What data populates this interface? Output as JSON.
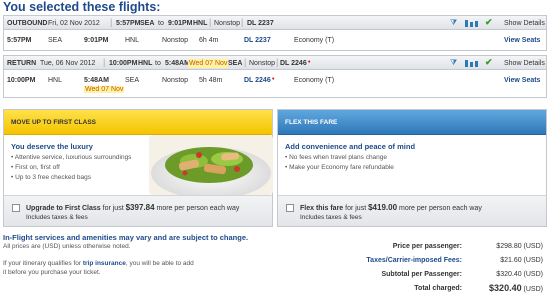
{
  "title": "You selected these flights:",
  "outbound": {
    "label": "OUTBOUND",
    "date": "Fri, 02 Nov 2012",
    "depart_time": "5:57PM",
    "from": "SEA",
    "to_word": "to",
    "arrive_time": "9:01PM",
    "to": "HNL",
    "stops": "Nonstop",
    "flight": "DL 2237",
    "show_details": "Show Details",
    "row": {
      "depart": "5:57PM",
      "from": "SEA",
      "arrive": "9:01PM",
      "to": "HNL",
      "stops": "Nonstop",
      "duration": "6h 4m",
      "flight": "DL 2237",
      "cabin": "Economy (T)",
      "view_seats": "View Seats"
    }
  },
  "return": {
    "label": "RETURN",
    "date": "Tue, 06 Nov 2012",
    "depart_time": "10:00PM",
    "from": "HNL",
    "to_word": "to",
    "arrive_time": "5:48AM",
    "arrive_day": "Wed 07 Nov",
    "to": "SEA",
    "stops": "Nonstop",
    "flight": "DL 2246",
    "flight_mark": "•",
    "show_details": "Show Details",
    "row": {
      "depart": "10:00PM",
      "from": "HNL",
      "arrive": "5:48AM",
      "arrive_day": "Wed 07 Nov",
      "to": "SEA",
      "stops": "Nonstop",
      "duration": "5h 48m",
      "flight": "DL 2246",
      "flight_mark": "•",
      "cabin": "Economy (T)",
      "view_seats": "View Seats"
    }
  },
  "upsell_first": {
    "header": "MOVE UP TO FIRST CLASS",
    "heading": "You deserve the luxury",
    "bullets": [
      "Attentive service, luxurious surroundings",
      "First on, first off",
      "Up to 3 free checked bags"
    ],
    "option_pre": "Upgrade to First Class",
    "option_mid": "for just",
    "price": "$397.84",
    "option_post": "more per person  each way",
    "includes": "Includes taxes & fees"
  },
  "upsell_flex": {
    "header": "FLEX THIS FARE",
    "heading": "Add convenience and peace of mind",
    "bullets": [
      "No fees when travel plans change",
      "Make your Economy fare refundable"
    ],
    "option_pre": "Flex this fare",
    "option_mid": "for just",
    "price": "$419.00",
    "option_post": "more per person  each way",
    "includes": "Includes taxes & fees"
  },
  "notes": {
    "inflight": "In-Flight services and amenities may vary and are subject to change.",
    "usd": "All prices are (USD) unless otherwise noted.",
    "insurance_pre": "If your itinerary qualifies for",
    "insurance_link": "trip insurance",
    "insurance_post": ", you will be able to add",
    "insurance_line2": "it before you purchase your ticket."
  },
  "totals": {
    "per_passenger_label": "Price per passenger:",
    "per_passenger_value": "$298.80 (USD)",
    "taxes_label": "Taxes/Carrier-imposed Fees:",
    "taxes_value": "$21.60 (USD)",
    "subtotal_label": "Subtotal per Passenger:",
    "subtotal_value": "$320.40 (USD)",
    "total_label": "Total charged:",
    "total_value": "$320.40",
    "total_currency": "(USD)"
  },
  "colors": {
    "brand_blue": "#1e4a8c",
    "highlight": "#fff2a3",
    "first_class": "#f5c400",
    "flex": "#2f78b9"
  }
}
